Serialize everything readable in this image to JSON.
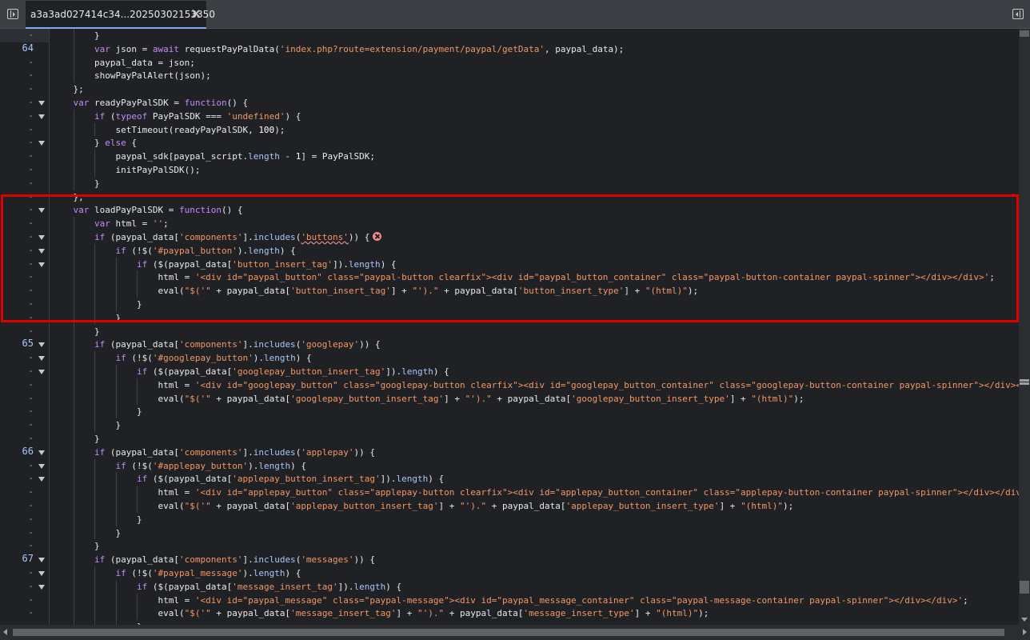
{
  "tab": {
    "file_name": "a3a3ad027414c34...20250302153350"
  },
  "colors": {
    "highlight_box": "#e00000",
    "keyword": "#c58af9",
    "string": "#f29766",
    "property": "#a8c7fa",
    "line_number": "#a8c7fa",
    "error": "#f28b82"
  },
  "icons": {
    "toggle_navigator": "sidebar-left-icon",
    "toggle_debugger": "sidebar-right-icon",
    "close_tab": "close-icon",
    "fold": "triangle-down-icon",
    "error": "error-circle-icon"
  },
  "gutter": [
    {
      "label": "-",
      "fold": false
    },
    {
      "label": "64",
      "fold": false
    },
    {
      "label": "-",
      "fold": false
    },
    {
      "label": "-",
      "fold": false
    },
    {
      "label": "-",
      "fold": false
    },
    {
      "label": "-",
      "fold": true
    },
    {
      "label": "-",
      "fold": true
    },
    {
      "label": "-",
      "fold": false
    },
    {
      "label": "-",
      "fold": true
    },
    {
      "label": "-",
      "fold": false
    },
    {
      "label": "-",
      "fold": false
    },
    {
      "label": "-",
      "fold": false
    },
    {
      "label": "-",
      "fold": false
    },
    {
      "label": "-",
      "fold": true
    },
    {
      "label": "-",
      "fold": false
    },
    {
      "label": "-",
      "fold": true
    },
    {
      "label": "-",
      "fold": true
    },
    {
      "label": "-",
      "fold": true
    },
    {
      "label": "-",
      "fold": false
    },
    {
      "label": "-",
      "fold": false
    },
    {
      "label": "-",
      "fold": false
    },
    {
      "label": "-",
      "fold": false
    },
    {
      "label": "-",
      "fold": false
    },
    {
      "label": "65",
      "fold": true
    },
    {
      "label": "-",
      "fold": true
    },
    {
      "label": "-",
      "fold": true
    },
    {
      "label": "-",
      "fold": false
    },
    {
      "label": "-",
      "fold": false
    },
    {
      "label": "-",
      "fold": false
    },
    {
      "label": "-",
      "fold": false
    },
    {
      "label": "-",
      "fold": false
    },
    {
      "label": "66",
      "fold": true
    },
    {
      "label": "-",
      "fold": true
    },
    {
      "label": "-",
      "fold": true
    },
    {
      "label": "-",
      "fold": false
    },
    {
      "label": "-",
      "fold": false
    },
    {
      "label": "-",
      "fold": false
    },
    {
      "label": "-",
      "fold": false
    },
    {
      "label": "-",
      "fold": false
    },
    {
      "label": "67",
      "fold": true
    },
    {
      "label": "-",
      "fold": true
    },
    {
      "label": "-",
      "fold": true
    },
    {
      "label": "-",
      "fold": false
    },
    {
      "label": "-",
      "fold": false
    },
    {
      "label": "-",
      "fold": false
    }
  ],
  "code_lines": [
    {
      "indent": 2,
      "tokens": [
        [
          "p",
          "}"
        ]
      ]
    },
    {
      "indent": 2,
      "tokens": [
        [
          "k",
          "var"
        ],
        [
          "p",
          " json = "
        ],
        [
          "k",
          "await"
        ],
        [
          "p",
          " requestPayPalData("
        ],
        [
          "s",
          "'index.php?route=extension/payment/paypal/getData'"
        ],
        [
          "p",
          ", paypal_data);"
        ]
      ]
    },
    {
      "indent": 2,
      "tokens": [
        [
          "p",
          "paypal_data = json;"
        ]
      ]
    },
    {
      "indent": 2,
      "tokens": [
        [
          "p",
          "showPayPalAlert(json);"
        ]
      ]
    },
    {
      "indent": 1,
      "tokens": [
        [
          "p",
          "};"
        ]
      ]
    },
    {
      "indent": 1,
      "tokens": [
        [
          "k",
          "var"
        ],
        [
          "p",
          " readyPayPalSDK = "
        ],
        [
          "k",
          "function"
        ],
        [
          "p",
          "() {"
        ]
      ]
    },
    {
      "indent": 2,
      "tokens": [
        [
          "k",
          "if"
        ],
        [
          "p",
          " ("
        ],
        [
          "k",
          "typeof"
        ],
        [
          "p",
          " PayPalSDK === "
        ],
        [
          "s",
          "'undefined'"
        ],
        [
          "p",
          ") {"
        ]
      ]
    },
    {
      "indent": 3,
      "tokens": [
        [
          "p",
          "setTimeout(readyPayPalSDK, "
        ],
        [
          "n",
          "100"
        ],
        [
          "p",
          ");"
        ]
      ]
    },
    {
      "indent": 2,
      "tokens": [
        [
          "p",
          "} "
        ],
        [
          "k",
          "else"
        ],
        [
          "p",
          " {"
        ]
      ]
    },
    {
      "indent": 3,
      "tokens": [
        [
          "p",
          "paypal_sdk[paypal_script."
        ],
        [
          "a",
          "length"
        ],
        [
          "p",
          " - "
        ],
        [
          "n",
          "1"
        ],
        [
          "p",
          "] = PayPalSDK;"
        ]
      ]
    },
    {
      "indent": 3,
      "tokens": [
        [
          "p",
          "initPayPalSDK();"
        ]
      ]
    },
    {
      "indent": 2,
      "tokens": [
        [
          "p",
          "}"
        ]
      ]
    },
    {
      "indent": 1,
      "tokens": [
        [
          "p",
          "};"
        ]
      ]
    },
    {
      "indent": 1,
      "tokens": [
        [
          "k",
          "var"
        ],
        [
          "p",
          " loadPayPalSDK = "
        ],
        [
          "k",
          "function"
        ],
        [
          "p",
          "() {"
        ]
      ]
    },
    {
      "indent": 2,
      "tokens": [
        [
          "k",
          "var"
        ],
        [
          "p",
          " html = "
        ],
        [
          "s",
          "''"
        ],
        [
          "p",
          ";"
        ]
      ]
    },
    {
      "indent": 2,
      "tokens": [
        [
          "k",
          "if"
        ],
        [
          "p",
          " (paypal_data["
        ],
        [
          "s",
          "'components'"
        ],
        [
          "p",
          "]."
        ],
        [
          "a",
          "includes"
        ],
        [
          "p",
          "("
        ],
        [
          "e",
          "'buttons'"
        ],
        [
          "p",
          ")) {"
        ],
        [
          "x",
          ""
        ]
      ]
    },
    {
      "indent": 3,
      "tokens": [
        [
          "k",
          "if"
        ],
        [
          "p",
          " (!$("
        ],
        [
          "s",
          "'#paypal_button'"
        ],
        [
          "p",
          ")."
        ],
        [
          "a",
          "length"
        ],
        [
          "p",
          ") {"
        ]
      ]
    },
    {
      "indent": 4,
      "tokens": [
        [
          "k",
          "if"
        ],
        [
          "p",
          " ($(paypal_data["
        ],
        [
          "s",
          "'button_insert_tag'"
        ],
        [
          "p",
          "])."
        ],
        [
          "a",
          "length"
        ],
        [
          "p",
          ") {"
        ]
      ]
    },
    {
      "indent": 5,
      "tokens": [
        [
          "p",
          "html = "
        ],
        [
          "s",
          "'<div id=\"paypal_button\" class=\"paypal-button clearfix\"><div id=\"paypal_button_container\" class=\"paypal-button-container paypal-spinner\"></div></div>'"
        ],
        [
          "p",
          ";"
        ]
      ]
    },
    {
      "indent": 5,
      "tokens": [
        [
          "p",
          "eval("
        ],
        [
          "s",
          "\"$('\""
        ],
        [
          "p",
          " + paypal_data["
        ],
        [
          "s",
          "'button_insert_tag'"
        ],
        [
          "p",
          "] + "
        ],
        [
          "s",
          "\"').\""
        ],
        [
          "p",
          " + paypal_data["
        ],
        [
          "s",
          "'button_insert_type'"
        ],
        [
          "p",
          "] + "
        ],
        [
          "s",
          "\"(html)\""
        ],
        [
          "p",
          ");"
        ]
      ]
    },
    {
      "indent": 4,
      "tokens": [
        [
          "p",
          "}"
        ]
      ]
    },
    {
      "indent": 3,
      "tokens": [
        [
          "p",
          "}"
        ]
      ]
    },
    {
      "indent": 2,
      "tokens": [
        [
          "p",
          "}"
        ]
      ]
    },
    {
      "indent": 2,
      "tokens": [
        [
          "k",
          "if"
        ],
        [
          "p",
          " (paypal_data["
        ],
        [
          "s",
          "'components'"
        ],
        [
          "p",
          "]."
        ],
        [
          "a",
          "includes"
        ],
        [
          "p",
          "("
        ],
        [
          "s",
          "'googlepay'"
        ],
        [
          "p",
          ")) {"
        ]
      ]
    },
    {
      "indent": 3,
      "tokens": [
        [
          "k",
          "if"
        ],
        [
          "p",
          " (!$("
        ],
        [
          "s",
          "'#googlepay_button'"
        ],
        [
          "p",
          ")."
        ],
        [
          "a",
          "length"
        ],
        [
          "p",
          ") {"
        ]
      ]
    },
    {
      "indent": 4,
      "tokens": [
        [
          "k",
          "if"
        ],
        [
          "p",
          " ($(paypal_data["
        ],
        [
          "s",
          "'googlepay_button_insert_tag'"
        ],
        [
          "p",
          "])."
        ],
        [
          "a",
          "length"
        ],
        [
          "p",
          ") {"
        ]
      ]
    },
    {
      "indent": 5,
      "tokens": [
        [
          "p",
          "html = "
        ],
        [
          "s",
          "'<div id=\"googlepay_button\" class=\"googlepay-button clearfix\"><div id=\"googlepay_button_container\" class=\"googlepay-button-container paypal-spinner\"></div></div>'"
        ],
        [
          "p",
          ";"
        ]
      ]
    },
    {
      "indent": 5,
      "tokens": [
        [
          "p",
          "eval("
        ],
        [
          "s",
          "\"$('\""
        ],
        [
          "p",
          " + paypal_data["
        ],
        [
          "s",
          "'googlepay_button_insert_tag'"
        ],
        [
          "p",
          "] + "
        ],
        [
          "s",
          "\"').\""
        ],
        [
          "p",
          " + paypal_data["
        ],
        [
          "s",
          "'googlepay_button_insert_type'"
        ],
        [
          "p",
          "] + "
        ],
        [
          "s",
          "\"(html)\""
        ],
        [
          "p",
          ");"
        ]
      ]
    },
    {
      "indent": 4,
      "tokens": [
        [
          "p",
          "}"
        ]
      ]
    },
    {
      "indent": 3,
      "tokens": [
        [
          "p",
          "}"
        ]
      ]
    },
    {
      "indent": 2,
      "tokens": [
        [
          "p",
          "}"
        ]
      ]
    },
    {
      "indent": 2,
      "tokens": [
        [
          "k",
          "if"
        ],
        [
          "p",
          " (paypal_data["
        ],
        [
          "s",
          "'components'"
        ],
        [
          "p",
          "]."
        ],
        [
          "a",
          "includes"
        ],
        [
          "p",
          "("
        ],
        [
          "s",
          "'applepay'"
        ],
        [
          "p",
          ")) {"
        ]
      ]
    },
    {
      "indent": 3,
      "tokens": [
        [
          "k",
          "if"
        ],
        [
          "p",
          " (!$("
        ],
        [
          "s",
          "'#applepay_button'"
        ],
        [
          "p",
          ")."
        ],
        [
          "a",
          "length"
        ],
        [
          "p",
          ") {"
        ]
      ]
    },
    {
      "indent": 4,
      "tokens": [
        [
          "k",
          "if"
        ],
        [
          "p",
          " ($(paypal_data["
        ],
        [
          "s",
          "'applepay_button_insert_tag'"
        ],
        [
          "p",
          "])."
        ],
        [
          "a",
          "length"
        ],
        [
          "p",
          ") {"
        ]
      ]
    },
    {
      "indent": 5,
      "tokens": [
        [
          "p",
          "html = "
        ],
        [
          "s",
          "'<div id=\"applepay_button\" class=\"applepay-button clearfix\"><div id=\"applepay_button_container\" class=\"applepay-button-container paypal-spinner\"></div></div>'"
        ],
        [
          "p",
          ";"
        ]
      ]
    },
    {
      "indent": 5,
      "tokens": [
        [
          "p",
          "eval("
        ],
        [
          "s",
          "\"$('\""
        ],
        [
          "p",
          " + paypal_data["
        ],
        [
          "s",
          "'applepay_button_insert_tag'"
        ],
        [
          "p",
          "] + "
        ],
        [
          "s",
          "\"').\""
        ],
        [
          "p",
          " + paypal_data["
        ],
        [
          "s",
          "'applepay_button_insert_type'"
        ],
        [
          "p",
          "] + "
        ],
        [
          "s",
          "\"(html)\""
        ],
        [
          "p",
          ");"
        ]
      ]
    },
    {
      "indent": 4,
      "tokens": [
        [
          "p",
          "}"
        ]
      ]
    },
    {
      "indent": 3,
      "tokens": [
        [
          "p",
          "}"
        ]
      ]
    },
    {
      "indent": 2,
      "tokens": [
        [
          "p",
          "}"
        ]
      ]
    },
    {
      "indent": 2,
      "tokens": [
        [
          "k",
          "if"
        ],
        [
          "p",
          " (paypal_data["
        ],
        [
          "s",
          "'components'"
        ],
        [
          "p",
          "]."
        ],
        [
          "a",
          "includes"
        ],
        [
          "p",
          "("
        ],
        [
          "s",
          "'messages'"
        ],
        [
          "p",
          ")) {"
        ]
      ]
    },
    {
      "indent": 3,
      "tokens": [
        [
          "k",
          "if"
        ],
        [
          "p",
          " (!$("
        ],
        [
          "s",
          "'#paypal_message'"
        ],
        [
          "p",
          ")."
        ],
        [
          "a",
          "length"
        ],
        [
          "p",
          ") {"
        ]
      ]
    },
    {
      "indent": 4,
      "tokens": [
        [
          "k",
          "if"
        ],
        [
          "p",
          " ($(paypal_data["
        ],
        [
          "s",
          "'message_insert_tag'"
        ],
        [
          "p",
          "])."
        ],
        [
          "a",
          "length"
        ],
        [
          "p",
          ") {"
        ]
      ]
    },
    {
      "indent": 5,
      "tokens": [
        [
          "p",
          "html = "
        ],
        [
          "s",
          "'<div id=\"paypal_message\" class=\"paypal-message\"><div id=\"paypal_message_container\" class=\"paypal-message-container paypal-spinner\"></div></div>'"
        ],
        [
          "p",
          ";"
        ]
      ]
    },
    {
      "indent": 5,
      "tokens": [
        [
          "p",
          "eval("
        ],
        [
          "s",
          "\"$('\""
        ],
        [
          "p",
          " + paypal_data["
        ],
        [
          "s",
          "'message_insert_tag'"
        ],
        [
          "p",
          "] + "
        ],
        [
          "s",
          "\"').\""
        ],
        [
          "p",
          " + paypal_data["
        ],
        [
          "s",
          "'message_insert_type'"
        ],
        [
          "p",
          "] + "
        ],
        [
          "s",
          "\"(html)\""
        ],
        [
          "p",
          ");"
        ]
      ]
    },
    {
      "indent": 4,
      "tokens": [
        [
          "p",
          "}"
        ]
      ]
    }
  ]
}
